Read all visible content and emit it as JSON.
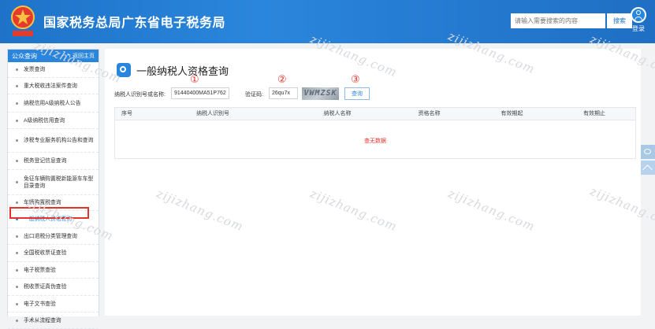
{
  "header": {
    "title": "国家税务总局广东省电子税务局",
    "search_placeholder": "请输入需要搜索的内容",
    "search_button": "搜索",
    "login_label": "登录",
    "emblem_text": "中国税务"
  },
  "sidebar": {
    "title": "公众查询",
    "back_label": "返回主页",
    "items": [
      {
        "label": "发票查询"
      },
      {
        "label": "重大税收违法案件查询"
      },
      {
        "label": "纳税信用A级纳税人公告"
      },
      {
        "label": "A级纳税信用查询"
      },
      {
        "label": "涉税专业服务机构公告和查询"
      },
      {
        "label": "税务登记信息查询"
      },
      {
        "label": "免征车辆购置税新能源车车型目录查询"
      },
      {
        "label": "车辆购置税查询"
      },
      {
        "label": "一般纳税人资格查询"
      },
      {
        "label": "出口退税分类管理查询"
      },
      {
        "label": "全国税收票证查验"
      },
      {
        "label": "电子税票查验"
      },
      {
        "label": "税收票证真伪查验"
      },
      {
        "label": "电子文书查验"
      },
      {
        "label": "手术从流程查询"
      }
    ]
  },
  "main": {
    "title": "一般纳税人资格查询",
    "taxpayer_label": "纳税人识别号或名称:",
    "taxpayer_value": "91440400MA51P7627N",
    "captcha_label": "验证码:",
    "captcha_value": "26qu7x",
    "captcha_image_text": "VWMZSK",
    "query_button": "查询",
    "annotations": [
      "①",
      "②",
      "③"
    ],
    "table": {
      "headers": [
        "序号",
        "纳税人识别号",
        "纳税人名称",
        "资格名称",
        "有效期起",
        "有效期止"
      ],
      "empty_text": "查无数据"
    }
  },
  "watermark": "zijizhang.com",
  "colors": {
    "header_blue": "#1e73c8",
    "accent_blue": "#2a86dc",
    "highlight_red": "#e5322d"
  }
}
